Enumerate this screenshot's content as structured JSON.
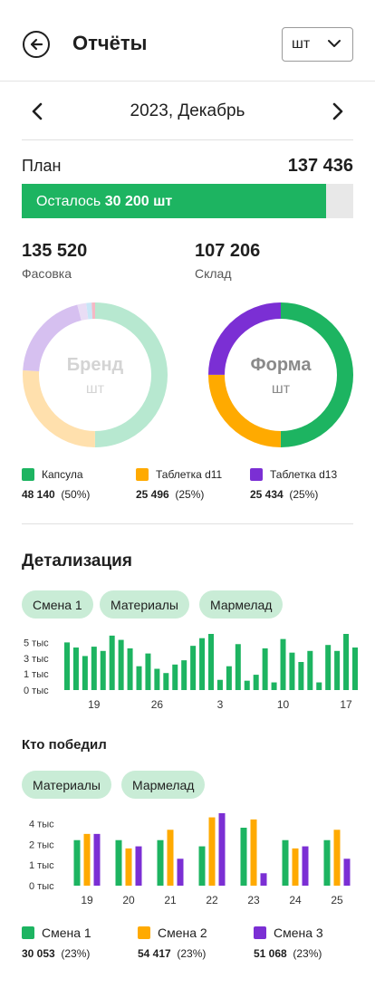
{
  "header": {
    "title": "Отчёты",
    "unit": "шт"
  },
  "period": {
    "label": "2023, Декабрь"
  },
  "plan": {
    "label": "План",
    "value": "137 436",
    "remaining_prefix": "Осталось",
    "remaining_value": "30 200 шт",
    "progress_fraction": 0.918
  },
  "stats": [
    {
      "value": "135 520",
      "label": "Фасовка"
    },
    {
      "value": "107 206",
      "label": "Склад"
    }
  ],
  "donuts": [
    {
      "title": "Бренд",
      "sub": "шт",
      "faded": true,
      "segments": [
        {
          "value": 0.5,
          "color": "#b7e8d0"
        },
        {
          "value": 0.26,
          "color": "#ffe0ad"
        },
        {
          "value": 0.2,
          "color": "#d6c0f0"
        },
        {
          "value": 0.02,
          "color": "#e9ddf5"
        },
        {
          "value": 0.012,
          "color": "#c9e6f7"
        },
        {
          "value": 0.008,
          "color": "#f5b8c4"
        }
      ]
    },
    {
      "title": "Форма",
      "sub": "шт",
      "faded": false,
      "segments": [
        {
          "value": 0.5,
          "color": "#1db461"
        },
        {
          "value": 0.25,
          "color": "#ffaa00"
        },
        {
          "value": 0.25,
          "color": "#7b2fd4"
        }
      ]
    }
  ],
  "legend1": [
    {
      "label": "Капсула",
      "value": "48 140",
      "pct": "(50%)",
      "color": "#1db461"
    },
    {
      "label": "Таблетка d11",
      "value": "25 496",
      "pct": "(25%)",
      "color": "#ffaa00"
    },
    {
      "label": "Таблетка d13",
      "value": "25 434",
      "pct": "(25%)",
      "color": "#7b2fd4"
    }
  ],
  "detail": {
    "title": "Детализация",
    "chips": [
      "Смена 1",
      "Материалы",
      "Мармелад"
    ]
  },
  "winner": {
    "title": "Кто победил",
    "chips": [
      "Материалы",
      "Мармелад"
    ]
  },
  "legend2": [
    {
      "label": "Смена 1",
      "value": "30 053",
      "pct": "(23%)",
      "color": "#1db461"
    },
    {
      "label": "Смена 2",
      "value": "54 417",
      "pct": "(23%)",
      "color": "#ffaa00"
    },
    {
      "label": "Смена 3",
      "value": "51 068",
      "pct": "(23%)",
      "color": "#7b2fd4"
    }
  ],
  "chart_data": [
    {
      "type": "bar",
      "yticks": [
        "5 тыс",
        "3 тыс",
        "1 тыс",
        "0 тыс"
      ],
      "ytick_values": [
        5.6,
        3.7,
        1.9,
        0
      ],
      "xtick_labels": [
        "19",
        "26",
        "3",
        "10",
        "17"
      ],
      "xtick_positions": [
        3,
        10,
        17,
        24,
        31
      ],
      "color": "#1db461",
      "values": [
        5.6,
        5.0,
        4.0,
        5.1,
        4.6,
        6.4,
        5.9,
        4.9,
        2.8,
        4.3,
        2.5,
        2.0,
        3.0,
        3.5,
        5.2,
        6.1,
        6.6,
        1.2,
        2.8,
        5.4,
        1.1,
        1.8,
        4.9,
        0.9,
        6.0,
        4.4,
        3.3,
        4.6,
        0.9,
        5.3,
        4.6,
        6.6,
        5.0
      ],
      "ylim": [
        0,
        6.6
      ]
    },
    {
      "type": "bar",
      "yticks": [
        "4 тыс",
        "2 тыс",
        "1 тыс",
        "0 тыс"
      ],
      "ytick_values": [
        3.0,
        2.0,
        1.0,
        0
      ],
      "categories": [
        "19",
        "20",
        "21",
        "22",
        "23",
        "24",
        "25"
      ],
      "series": [
        {
          "color": "#1db461",
          "values": [
            2.2,
            2.2,
            2.2,
            1.9,
            2.8,
            2.2,
            2.2
          ]
        },
        {
          "color": "#ffaa00",
          "values": [
            2.5,
            1.8,
            2.7,
            3.3,
            3.2,
            1.8,
            2.7
          ]
        },
        {
          "color": "#7b2fd4",
          "values": [
            2.5,
            1.9,
            1.3,
            3.5,
            0.6,
            1.9,
            1.3
          ]
        }
      ],
      "ylim": [
        0,
        3.5
      ]
    }
  ]
}
